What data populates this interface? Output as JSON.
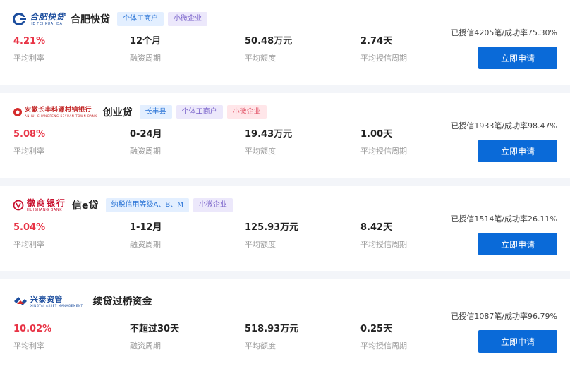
{
  "labels": {
    "rate": "平均利率",
    "term": "融资周期",
    "amount": "平均额度",
    "cycle": "平均授信周期",
    "apply": "立即申请"
  },
  "colors": {
    "accent": "#0a6ad8",
    "rate_red": "#e83446",
    "divider": "#f3f5f9"
  },
  "cards": [
    {
      "bank_logo_text": "合肥快贷",
      "bank_logo_sub": "HE FEI KUAI DAI",
      "logo_icon": "hefei-kuaidai-logo-icon",
      "product": "合肥快贷",
      "tags": [
        "个体工商户",
        "小微企业"
      ],
      "stats": "已授信4205笔/成功率75.30%",
      "rate": "4.21%",
      "term": "12个月",
      "amount": "50.48万元",
      "cycle": "2.74天"
    },
    {
      "bank_logo_text": "安徽长丰科源村镇银行",
      "bank_logo_sub": "ANHUI CHANGFENG KEYUAN TOWN BANK",
      "logo_icon": "changfeng-bank-logo-icon",
      "product": "创业贷",
      "tags": [
        "长丰县",
        "个体工商户",
        "小微企业"
      ],
      "stats": "已授信1933笔/成功率98.47%",
      "rate": "5.08%",
      "term": "0-24月",
      "amount": "19.43万元",
      "cycle": "1.00天"
    },
    {
      "bank_logo_text": "徽商银行",
      "bank_logo_sub": "HUISHANG BANK",
      "logo_icon": "huishang-bank-logo-icon",
      "product": "信e贷",
      "tags": [
        "纳税信用等级A、B、M",
        "小微企业"
      ],
      "stats": "已授信1514笔/成功率26.11%",
      "rate": "5.04%",
      "term": "1-12月",
      "amount": "125.93万元",
      "cycle": "8.42天"
    },
    {
      "bank_logo_text": "兴泰资管",
      "bank_logo_sub": "XINGTAI ASSET MANAGEMENT",
      "logo_icon": "xingtai-logo-icon",
      "product": "续贷过桥资金",
      "tags": [],
      "stats": "已授信1087笔/成功率96.79%",
      "rate": "10.02%",
      "term": "不超过30天",
      "amount": "518.93万元",
      "cycle": "0.25天"
    }
  ]
}
